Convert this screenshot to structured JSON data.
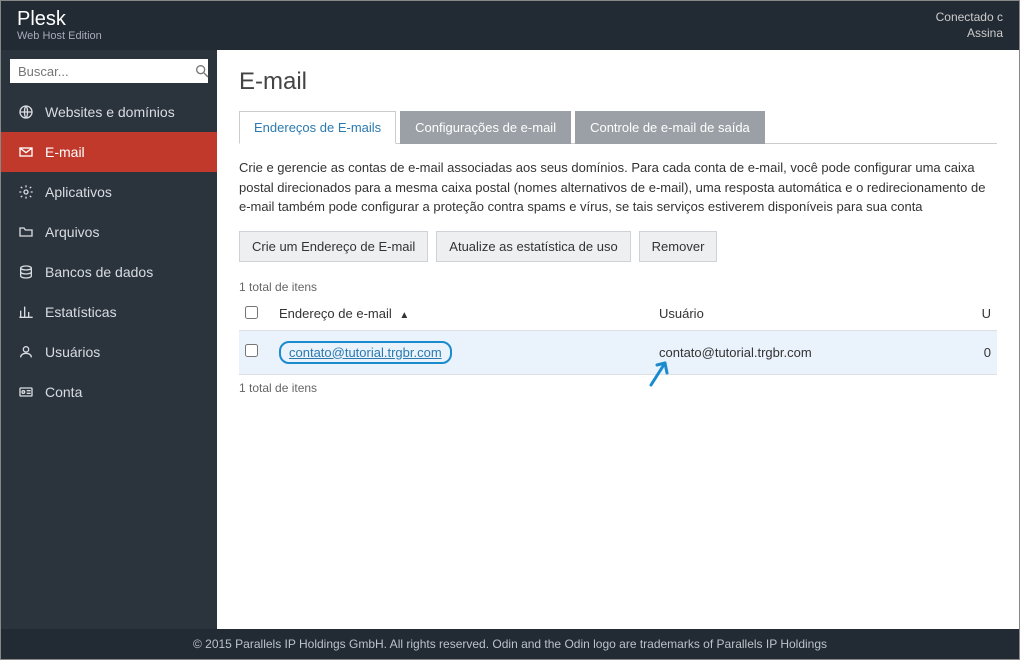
{
  "brand": {
    "title": "Plesk",
    "subtitle": "Web Host Edition"
  },
  "topbar": {
    "line1": "Conectado c",
    "line2": "Assina"
  },
  "search": {
    "placeholder": "Buscar..."
  },
  "sidebar": {
    "items": [
      {
        "label": "Websites e domínios"
      },
      {
        "label": "E-mail"
      },
      {
        "label": "Aplicativos"
      },
      {
        "label": "Arquivos"
      },
      {
        "label": "Bancos de dados"
      },
      {
        "label": "Estatísticas"
      },
      {
        "label": "Usuários"
      },
      {
        "label": "Conta"
      }
    ]
  },
  "page": {
    "title": "E-mail",
    "tabs": [
      {
        "label": "Endereços de E-mails"
      },
      {
        "label": "Configurações de e-mail"
      },
      {
        "label": "Controle de e-mail de saída"
      }
    ],
    "description": "Crie e gerencie as contas de e-mail associadas aos seus domínios. Para cada conta de e-mail, você pode configurar uma caixa postal direcionados para a mesma caixa postal (nomes alternativos de e-mail), uma resposta automática e o redirecionamento de e-mail também pode configurar a proteção contra spams e vírus, se tais serviços estiverem disponíveis para sua conta",
    "buttons": {
      "create": "Crie um Endereço de E-mail",
      "update": "Atualize as estatística de uso",
      "remove": "Remover"
    },
    "count": "1 total de itens",
    "columns": {
      "email": "Endereço de e-mail",
      "user": "Usuário",
      "u": "U"
    },
    "rows": [
      {
        "email": "contato@tutorial.trgbr.com",
        "user": "contato@tutorial.trgbr.com",
        "u": "0"
      }
    ]
  },
  "footer": "© 2015 Parallels IP Holdings GmbH. All rights reserved. Odin and the Odin logo are trademarks of Parallels IP Holdings"
}
